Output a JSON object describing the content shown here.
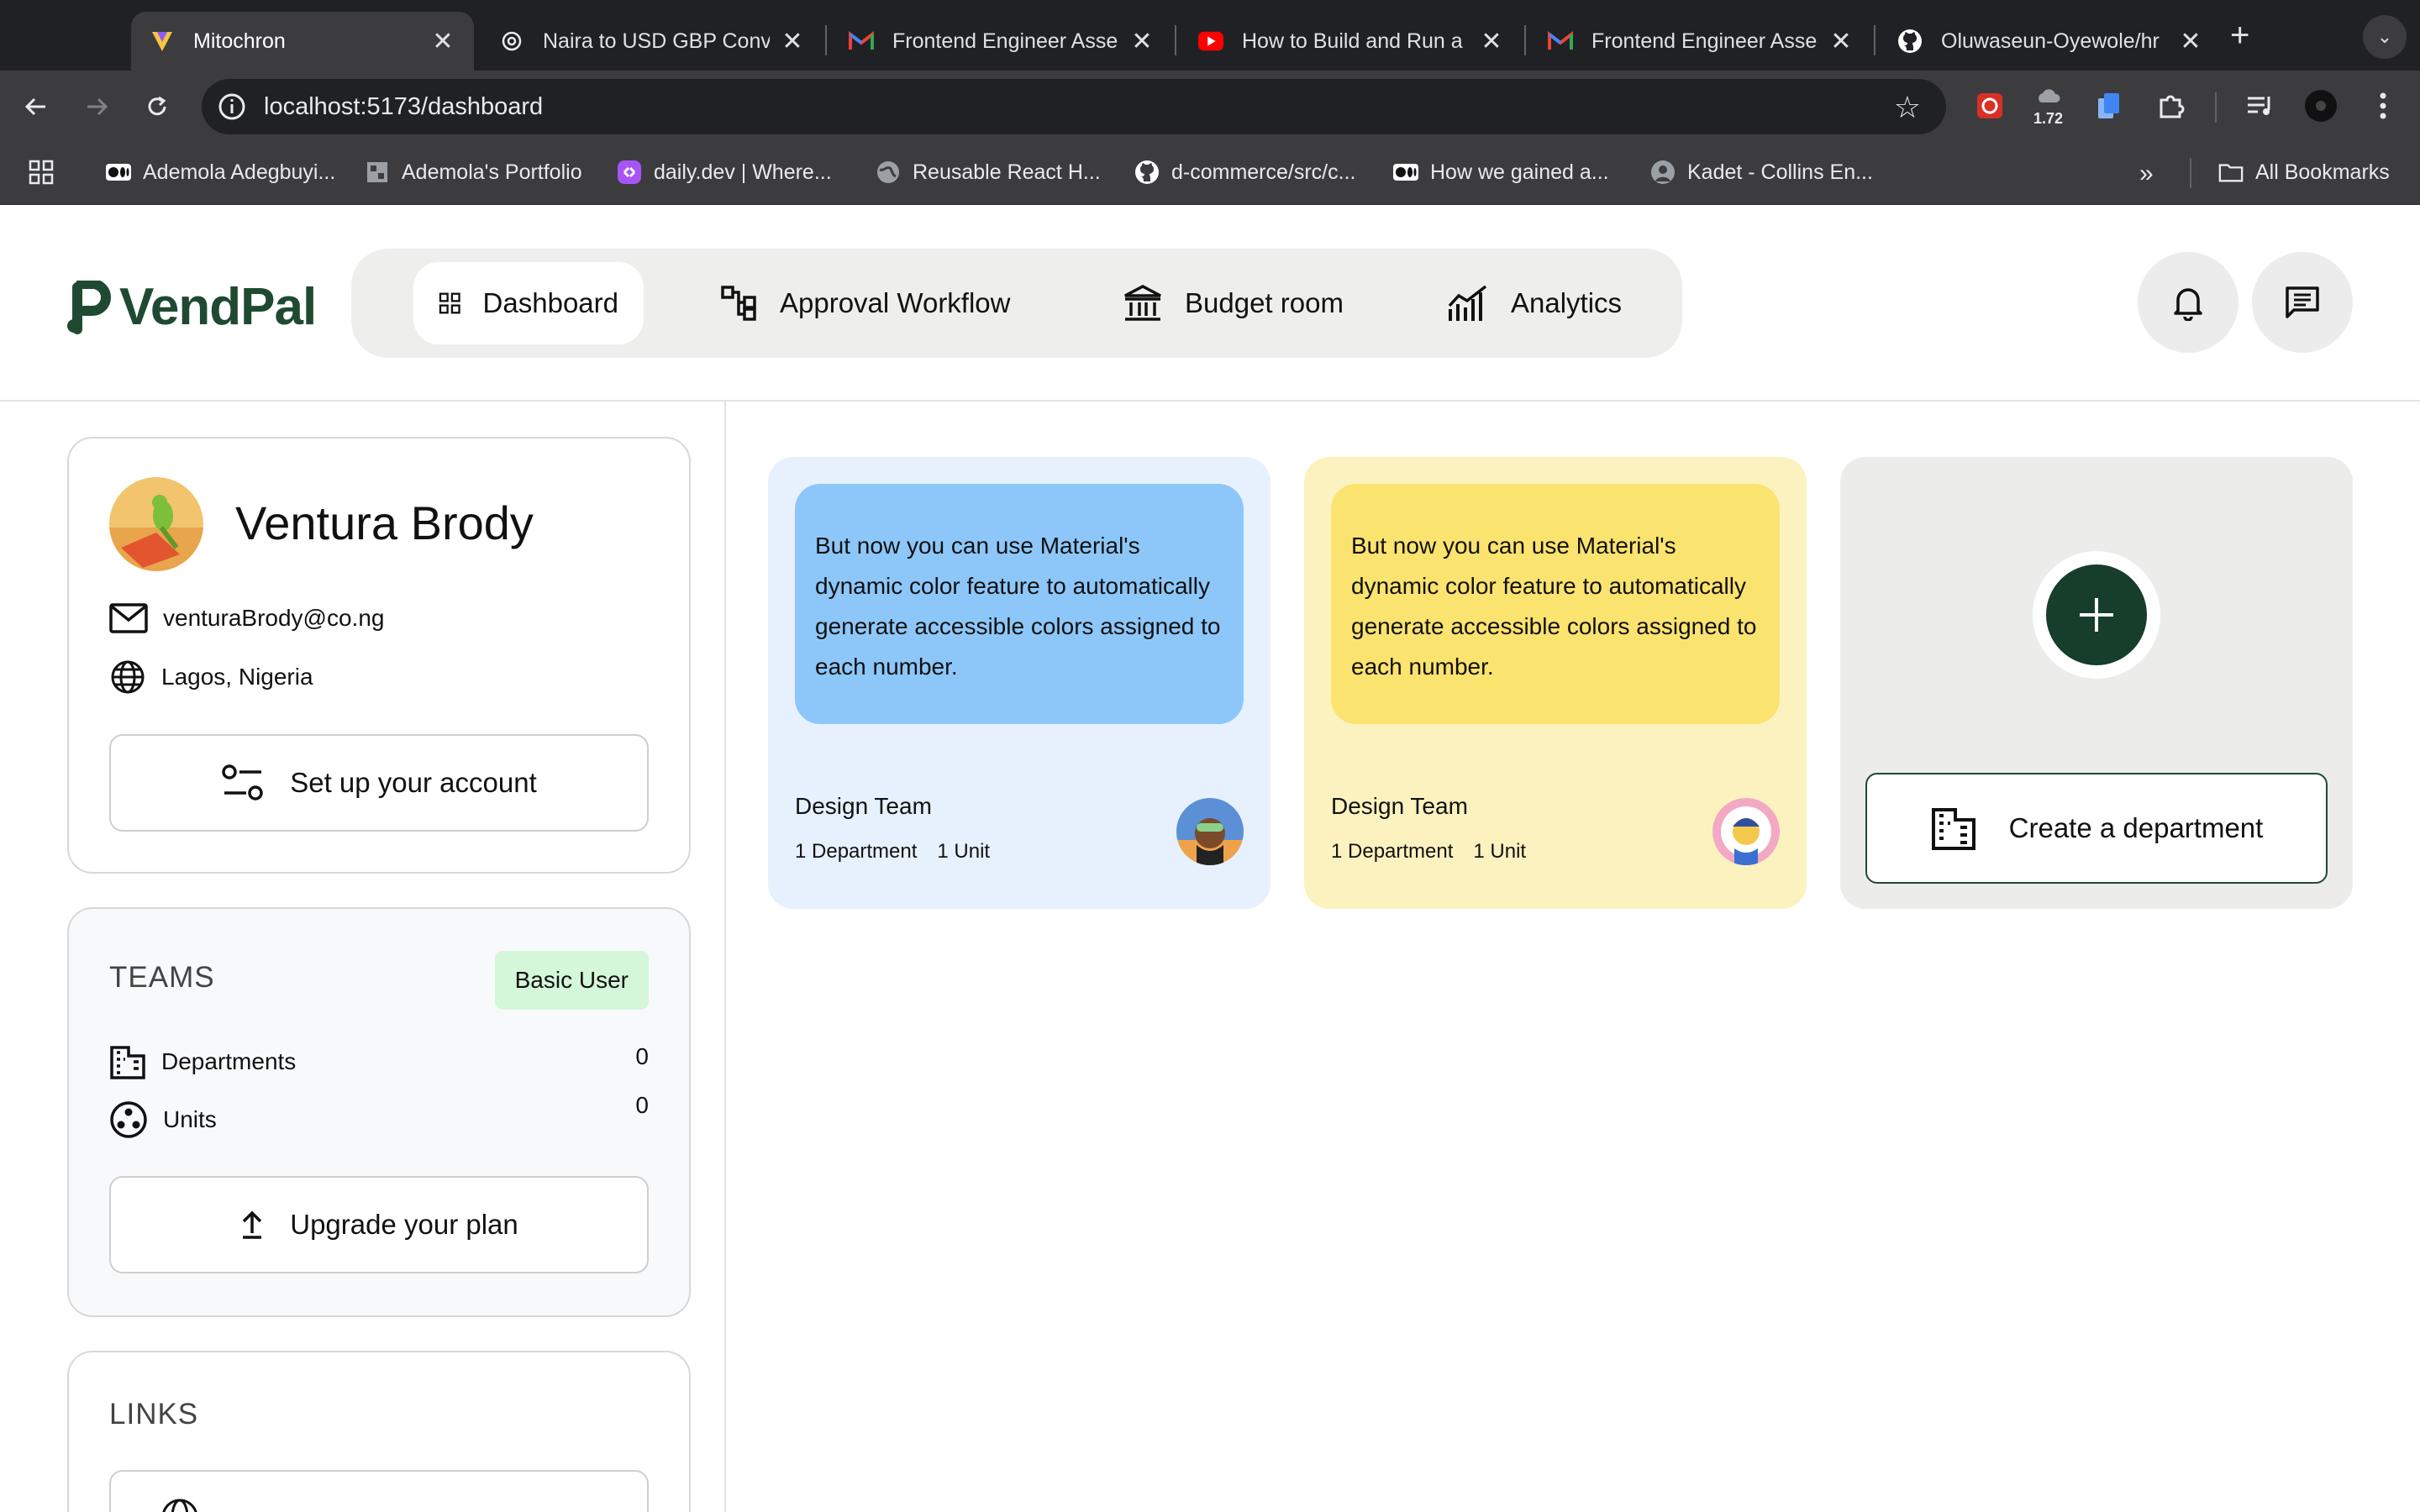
{
  "browser": {
    "tabs": [
      {
        "title": "Mitochron",
        "active": true,
        "favicon": "mitochron-icon"
      },
      {
        "title": "Naira to USD GBP Conve",
        "active": false,
        "favicon": "openai-icon"
      },
      {
        "title": "Frontend Engineer Asse",
        "active": false,
        "favicon": "gmail-icon"
      },
      {
        "title": "How to Build and Run a",
        "active": false,
        "favicon": "youtube-icon"
      },
      {
        "title": "Frontend Engineer Asse",
        "active": false,
        "favicon": "gmail-icon"
      },
      {
        "title": "Oluwaseun-Oyewole/hr",
        "active": false,
        "favicon": "github-icon"
      }
    ],
    "url": "localhost:5173/dashboard",
    "extension_badge": "1.72",
    "bookmarks": [
      {
        "label": "Ademola Adegbuyi...",
        "icon": "medium-icon"
      },
      {
        "label": "Ademola's Portfolio",
        "icon": "portfolio-icon"
      },
      {
        "label": "daily.dev | Where...",
        "icon": "dailydev-icon"
      },
      {
        "label": "Reusable React H...",
        "icon": "globe-icon"
      },
      {
        "label": "d-commerce/src/c...",
        "icon": "github-icon"
      },
      {
        "label": "How we gained a...",
        "icon": "medium-icon"
      },
      {
        "label": "Kadet - Collins En...",
        "icon": "person-icon"
      }
    ],
    "all_bookmarks_label": "All Bookmarks"
  },
  "app": {
    "brand": "VendPal",
    "nav": [
      {
        "label": "Dashboard",
        "icon": "grid-icon",
        "active": true
      },
      {
        "label": "Approval Workflow",
        "icon": "workflow-icon",
        "active": false
      },
      {
        "label": "Budget room",
        "icon": "bank-icon",
        "active": false
      },
      {
        "label": "Analytics",
        "icon": "chart-icon",
        "active": false
      }
    ]
  },
  "profile": {
    "name": "Ventura Brody",
    "email": "venturaBrody@co.ng",
    "location": "Lagos, Nigeria",
    "setup_label": "Set up your account"
  },
  "teams": {
    "title": "TEAMS",
    "badge": "Basic User",
    "departments_label": "Departments",
    "departments_value": "0",
    "units_label": "Units",
    "units_value": "0",
    "upgrade_label": "Upgrade your plan"
  },
  "links": {
    "title": "LINKS"
  },
  "cards": [
    {
      "description": "But now you can use Material's dynamic color feature to automatically generate accessible colors assigned to each number.",
      "name": "Design Team",
      "departments": "1 Department",
      "units": "1 Unit",
      "bg": "#e7f1fd",
      "inner_bg": "#8dc7f9"
    },
    {
      "description": "But now you can use Material's dynamic color feature to automatically generate accessible colors assigned to each number.",
      "name": "Design Team",
      "departments": "1 Department",
      "units": "1 Unit",
      "bg": "#fcf2bf",
      "inner_bg": "#fbe36f"
    }
  ],
  "create": {
    "label": "Create a department"
  },
  "colors": {
    "brand_green": "#1f4a31",
    "plus_button": "#163e2a",
    "badge_bg": "#d4f6d9"
  }
}
